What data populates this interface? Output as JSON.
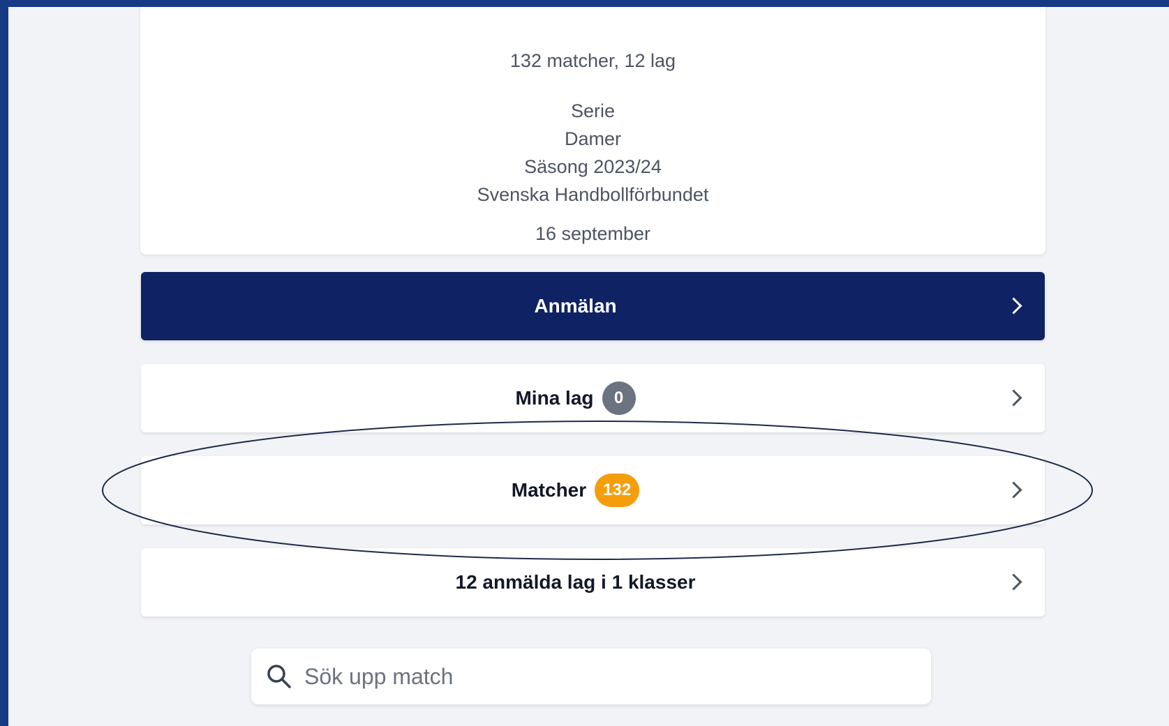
{
  "info": {
    "summary": "132 matcher, 12 lag",
    "type": "Serie",
    "gender": "Damer",
    "season": "Säsong 2023/24",
    "organizer": "Svenska Handbollförbundet",
    "date": "16 september"
  },
  "buttons": {
    "anmalan": {
      "label": "Anmälan"
    },
    "mina_lag": {
      "label": "Mina lag",
      "count": "0"
    },
    "matcher": {
      "label": "Matcher",
      "count": "132"
    },
    "klasser": {
      "label": "12 anmälda lag i 1 klasser"
    }
  },
  "search": {
    "placeholder": "Sök upp match",
    "value": ""
  },
  "colors": {
    "primary": "#0f2264",
    "badge_gray": "#6b7280",
    "badge_orange": "#f59e0b",
    "frame": "#173a86"
  }
}
